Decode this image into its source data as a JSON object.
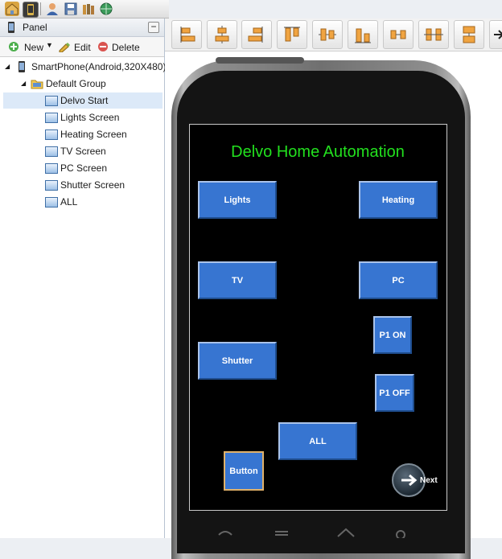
{
  "topbar": {
    "icons": [
      "home-icon",
      "phone-screen-icon",
      "user-icon",
      "save-icon",
      "library-icon",
      "globe-icon"
    ]
  },
  "panel": {
    "title": "Panel",
    "collapse_symbol": "−",
    "toolbar": {
      "new_label": "New",
      "edit_label": "Edit",
      "delete_label": "Delete"
    },
    "tree": {
      "device": "SmartPhone(Android,320X480)",
      "group": "Default Group",
      "screens": [
        "Delvo Start",
        "Lights Screen",
        "Heating Screen",
        "TV Screen",
        "PC Screen",
        "Shutter Screen",
        "ALL"
      ],
      "selected_screen": "Delvo Start"
    }
  },
  "design_toolbar": {
    "icons": [
      "align-left-icon",
      "align-center-icon",
      "align-right-icon",
      "align-top-icon",
      "align-middle-icon",
      "align-bottom-icon",
      "distribute-horizontal-icon",
      "distribute-vertical-icon",
      "same-size-icon",
      "arrow-right-icon"
    ]
  },
  "phone_screen": {
    "title": "Delvo Home Automation",
    "title_color": "#22e01e",
    "button_color": "#3775d1",
    "buttons": {
      "lights": "Lights",
      "heating": "Heating",
      "tv": "TV",
      "pc": "PC",
      "p1_on": "P1 ON",
      "shutter": "Shutter",
      "p1_off": "P1 OFF",
      "all": "ALL",
      "button": "Button"
    },
    "next_label": "Next"
  }
}
